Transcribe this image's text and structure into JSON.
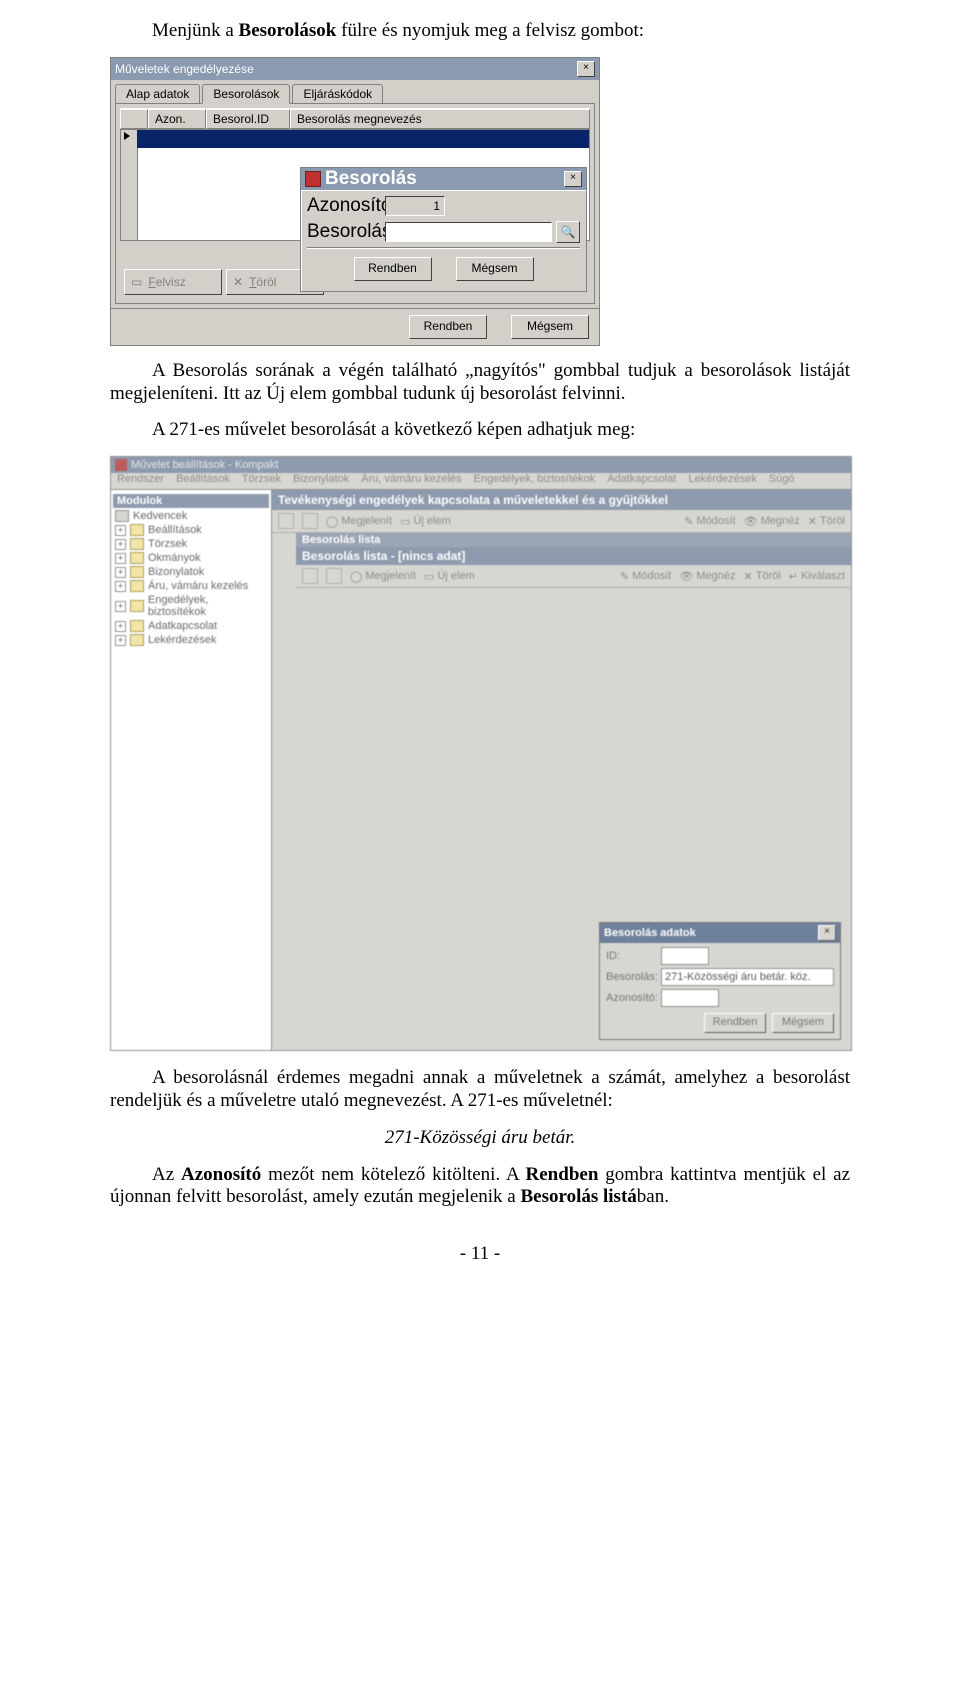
{
  "text": {
    "p1_a": "Menjünk a ",
    "p1_b": "Besorolások",
    "p1_c": " fülre és nyomjuk meg a felvisz gombot:",
    "p2": "A Besorolás sorának a végén található „nagyítós\" gombbal tudjuk a besorolások listáját megjeleníteni. Itt az Új elem gombbal tudunk új besorolást felvinni.",
    "p3": "A 271-es művelet besorolását a következő képen adhatjuk meg:",
    "p4_a": "A besorolásnál érdemes megadni annak a műveletnek a számát, amelyhez a besorolást rendeljük és a műveletre utaló megnevezést. A 271-es műveletnél:",
    "p4_b": "271-Közösségi áru betár.",
    "p5_a": "Az ",
    "p5_b": "Azonosító",
    "p5_c": " mezőt nem kötelező kitölteni. A ",
    "p5_d": "Rendben",
    "p5_e": " gombra kattintva mentjük el az újonnan felvitt besorolást, amely ezután megjelenik a ",
    "p5_f": "Besorolás listá",
    "p5_g": "ban.",
    "pagenum": "- 11 -"
  },
  "win1": {
    "title": "Műveletek engedélyezése",
    "tabs": [
      "Alap adatok",
      "Besorolások",
      "Eljáráskódok"
    ],
    "cols": [
      "Azon.",
      "Besorol.ID",
      "Besorolás megnevezés"
    ],
    "dlg_title": "Besorolás",
    "lbl_azon": "Azonosító:",
    "lbl_bes": "Besorolás:",
    "val_azon": "1",
    "btn_ok": "Rendben",
    "btn_cancel": "Mégsem",
    "btn_felvisz": "Felvisz",
    "btn_torol": "Töröl",
    "btn_ok2": "Rendben",
    "btn_cancel2": "Mégsem"
  },
  "win2": {
    "apptitle": "Művelet beállítások - Kompakt",
    "menus": [
      "Rendszer",
      "Beállítások",
      "Törzsek",
      "Bizonylatok",
      "Áru, vámáru kezelés",
      "Engedélyek, biztosítékok",
      "Adatkapcsolat",
      "Lekérdezések",
      "Súgó"
    ],
    "treehdr": "Modulok",
    "tree": [
      "Kedvencek",
      "Beállítások",
      "Törzsek",
      "Okmányok",
      "Bizonylatok",
      "Áru, vámáru kezelés",
      "Engedélyek, biztosítékok",
      "Adatkapcsolat",
      "Lekérdezések"
    ],
    "panel1": "Tevékenységi engedélyek kapcsolata a műveletekkel és a gyűjtőkkel",
    "tb1": [
      "Megjelenít",
      "Új elem",
      "Módosít",
      "Megnéz",
      "Töröl"
    ],
    "subtitle": "Besorolás lista",
    "panel2": "Besorolás lista - [nincs adat]",
    "tb2": [
      "Megjelenít",
      "Új elem",
      "Módosít",
      "Megnéz",
      "Töröl",
      "Kiválaszt"
    ],
    "dlg_title": "Besorolás adatok",
    "lbl_id": "ID:",
    "lbl_bes": "Besorolás:",
    "lbl_az": "Azonosító:",
    "val_bes": "271-Közösségi áru betár. köz.",
    "btn_ok": "Rendben",
    "btn_cancel": "Mégsem"
  }
}
